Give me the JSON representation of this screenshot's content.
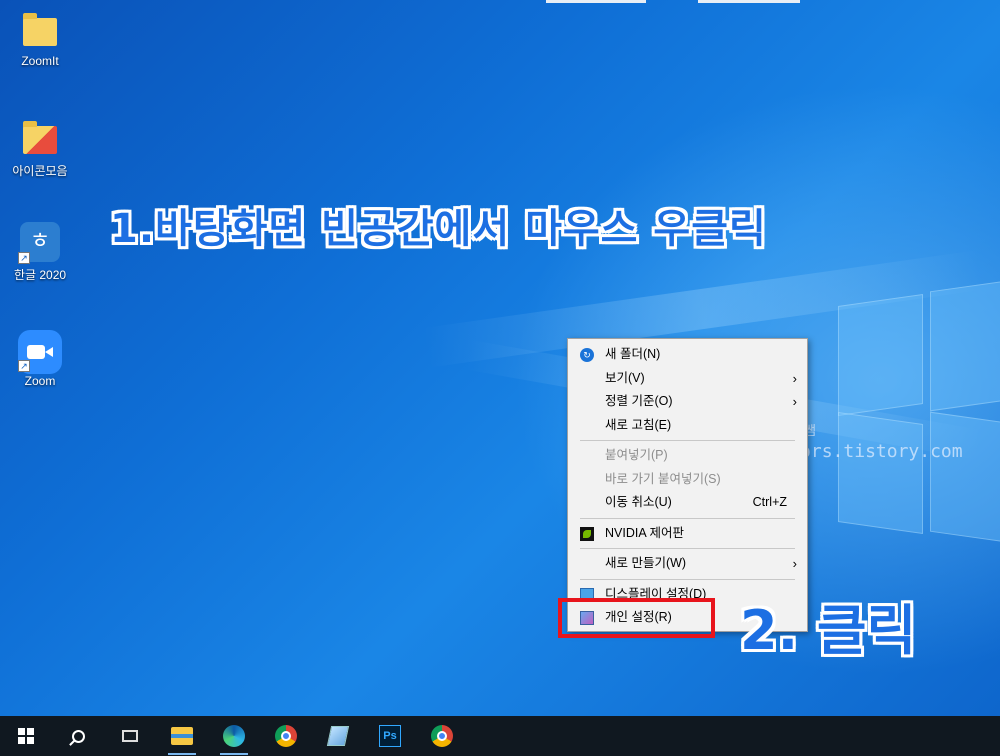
{
  "desktop": {
    "icons": [
      {
        "label": "ZoomIt",
        "icon": "folder-icon"
      },
      {
        "label": "아이콘모음",
        "icon": "folder-icon"
      },
      {
        "label": "한글 2020",
        "icon": "hangul-app-icon",
        "glyph": "ㅎ"
      },
      {
        "label": "Zoom",
        "icon": "zoom-app-icon"
      }
    ],
    "background_colors": [
      "#0a52b8",
      "#1a86e6"
    ]
  },
  "annotations": {
    "step1": "1.바탕화면 빈공간에서 마우스 우클릭",
    "step2": "2. 클릭",
    "highlight_color": "#e8141c",
    "text_color": "#1d6fe3"
  },
  "watermark": {
    "line1": "쉬운쌤",
    "line2": "https://fervors.tistory.com"
  },
  "context_menu": {
    "items": [
      {
        "label": "새 폴더(N)",
        "icon": "new-folder-icon"
      },
      {
        "label": "보기(V)",
        "submenu": "›"
      },
      {
        "label": "정렬 기준(O)",
        "submenu": "›"
      },
      {
        "label": "새로 고침(E)"
      },
      {
        "label": "붙여넣기(P)",
        "disabled": true
      },
      {
        "label": "바로 가기 붙여넣기(S)",
        "disabled": true
      },
      {
        "label": "이동 취소(U)",
        "shortcut": "Ctrl+Z"
      },
      {
        "label": "NVIDIA 제어판",
        "icon": "nvidia-icon"
      },
      {
        "label": "새로 만들기(W)",
        "submenu": "›"
      },
      {
        "label": "디스플레이 설정(D)",
        "icon": "display-icon"
      },
      {
        "label": "개인 설정(R)",
        "icon": "personalize-icon"
      }
    ]
  },
  "taskbar": {
    "items": [
      "start-icon",
      "search-icon",
      "task-view-icon",
      "file-explorer-icon",
      "edge-icon",
      "chrome-icon",
      "notes-icon",
      "photoshop-icon",
      "chrome-profile-icon"
    ],
    "photoshop_label": "Ps",
    "background": "#101820"
  }
}
